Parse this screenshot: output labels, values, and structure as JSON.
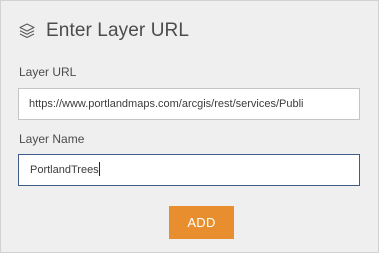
{
  "header": {
    "icon": "layers-icon",
    "title": "Enter Layer URL"
  },
  "form": {
    "layer_url_label": "Layer URL",
    "layer_url_value": "https://www.portlandmaps.com/arcgis/rest/services/Publi",
    "layer_name_label": "Layer Name",
    "layer_name_value": "PortlandTrees"
  },
  "actions": {
    "add_label": "ADD"
  },
  "colors": {
    "accent": "#e88e2e",
    "focus_border": "#3d5d86",
    "panel_bg": "#efefef"
  }
}
